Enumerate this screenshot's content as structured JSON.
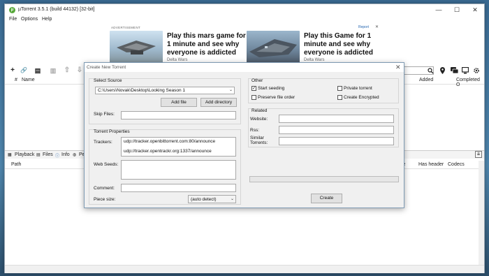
{
  "window": {
    "title": "µTorrent 3.5.1  (build 44132) [32-bit]",
    "logo": "µ",
    "controls": {
      "minimize": "—",
      "maximize": "☐",
      "close": "✕"
    }
  },
  "menu": [
    "File",
    "Options",
    "Help"
  ],
  "ad": {
    "advertisement_label": "ADVERTISEMENT",
    "report_label": "Report",
    "close_glyph": "✕",
    "items": [
      {
        "headline": "Play this mars game for 1 minute and see why everyone is addicted",
        "source": "Delta Wars"
      },
      {
        "headline": "Play this Game for 1 minute and see why everyone is addicted",
        "source": "Delta Wars"
      }
    ]
  },
  "toolbar": {
    "add": "+",
    "add_link": "🔗",
    "create": "▤",
    "remove": "▥",
    "up": "⇧",
    "down": "⇩"
  },
  "columns": {
    "num": "#",
    "name": "Name",
    "added": "Added",
    "completed_on": "Completed O"
  },
  "bottom_tabs": [
    "Playback",
    "Files",
    "Info",
    "Pe"
  ],
  "file_columns": {
    "path": "Path",
    "able": "able",
    "has_header": "Has header",
    "codecs": "Codecs"
  },
  "dialog": {
    "title": "Create New Torrent",
    "close_glyph": "✕",
    "select_source": {
      "label": "Select Source",
      "path_value": "C:\\Users\\Novak\\Desktop\\Looking Season 1",
      "add_file": "Add file",
      "add_directory": "Add directory",
      "skip_files_label": "Skip Files:",
      "skip_files_value": ""
    },
    "torrent_properties": {
      "label": "Torrent Properties",
      "trackers_label": "Trackers:",
      "trackers": [
        "udp://tracker.openbittorrent.com:80/announce",
        "udp://tracker.opentrackr.org:1337/announce"
      ],
      "web_seeds_label": "Web Seeds:",
      "comment_label": "Comment:",
      "piece_size_label": "Piece size:",
      "piece_size_value": "(auto detect)"
    },
    "other": {
      "label": "Other",
      "start_seeding": {
        "label": "Start seeding",
        "checked": true
      },
      "private_torrent": {
        "label": "Private torrent",
        "checked": false
      },
      "preserve_file_order": {
        "label": "Preserve file order",
        "checked": false
      },
      "create_encrypted": {
        "label": "Create Encrypted",
        "checked": false
      }
    },
    "related": {
      "label": "Related",
      "website_label": "Website:",
      "rss_label": "Rss:",
      "similar_torrents_label": "Similar\nTorrents:"
    },
    "create_button": "Create"
  }
}
